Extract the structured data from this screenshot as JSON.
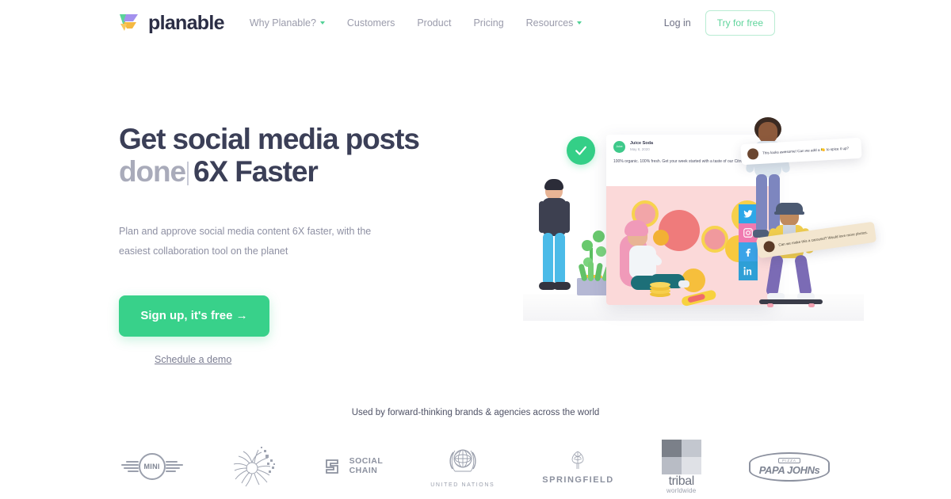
{
  "nav": {
    "logo_text": "planable",
    "links": [
      {
        "label": "Why Planable?",
        "has_caret": true
      },
      {
        "label": "Customers",
        "has_caret": false
      },
      {
        "label": "Product",
        "has_caret": false
      },
      {
        "label": "Pricing",
        "has_caret": false
      },
      {
        "label": "Resources",
        "has_caret": true
      }
    ],
    "login_label": "Log in",
    "try_label": "Try for free"
  },
  "hero": {
    "headline_line1": "Get social media posts",
    "headline_done": "done",
    "headline_rest": "6X Faster",
    "subhead": "Plan and approve social media content 6X faster, with the easiest collaboration tool on the planet",
    "cta_label": "Sign up, it's free →",
    "demo_label": "Schedule a demo"
  },
  "illustration": {
    "post": {
      "author": "Juice Soda",
      "date": "May 8, 2020",
      "caption": "100% organic. 100% fresh. Get your week started with a taste of our Citrus Juice",
      "avatar_text": "Juice"
    },
    "comments": [
      {
        "text": "This looks awesome! Can we add a 🍋 to spice it up?"
      },
      {
        "text": "Can we make this a carousel? Would love more photos."
      }
    ],
    "social_icons": [
      "twitter-icon",
      "instagram-icon",
      "facebook-icon",
      "linkedin-icon"
    ],
    "approved_icon": "check-circle-icon"
  },
  "brands": {
    "label": "Used by forward-thinking brands & agencies across the world",
    "items": [
      {
        "name": "MINI",
        "text": "MINI"
      },
      {
        "name": "burst-logo",
        "text": ""
      },
      {
        "name": "Social Chain",
        "line1": "SOCIAL",
        "line2": "CHAIN"
      },
      {
        "name": "United Nations",
        "text": "UNITED NATIONS"
      },
      {
        "name": "Springfield",
        "text": "SPRINGFIELD"
      },
      {
        "name": "Tribal Worldwide",
        "text": "tribal",
        "sub": "worldwide"
      },
      {
        "name": "Papa Johns",
        "top": "PIZZA",
        "text": "PAPA JOHNs"
      }
    ]
  },
  "colors": {
    "brand_green": "#38d18a",
    "headline_dark": "#3b3f57",
    "headline_gray": "#a9abba",
    "nav_gray": "#9a9bab",
    "post_bg_pink": "#fbd9d9"
  }
}
